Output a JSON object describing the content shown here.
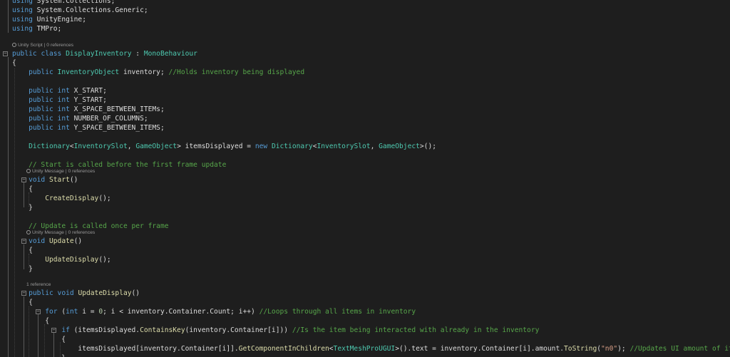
{
  "editor": {
    "colors": {
      "background": "#1e1e1e",
      "keyword": "#569cd6",
      "type": "#4ec9b0",
      "method": "#dcdcaa",
      "comment": "#57a64a",
      "string": "#d69d85",
      "plain": "#dcdcdc"
    },
    "collapse_icon": "minus-box-icon",
    "lines": [
      [
        [
          "kw",
          "using"
        ],
        [
          "pl",
          " System.Collections;"
        ]
      ],
      [
        [
          "kw",
          "using"
        ],
        [
          "pl",
          " System.Collections.Generic;"
        ]
      ],
      [
        [
          "kw",
          "using"
        ],
        [
          "pl",
          " UnityEngine;"
        ]
      ],
      [
        [
          "kw",
          "using"
        ],
        [
          "pl",
          " TMPro;"
        ]
      ],
      [
        [
          "kw",
          "public"
        ],
        [
          "pl",
          " "
        ],
        [
          "kw",
          "class"
        ],
        [
          "pl",
          " "
        ],
        [
          "ty",
          "DisplayInventory"
        ],
        [
          "pl",
          " : "
        ],
        [
          "ty",
          "MonoBehaviour"
        ]
      ],
      [
        [
          "pl",
          "{"
        ]
      ],
      [
        [
          "pl",
          "    "
        ],
        [
          "kw",
          "public"
        ],
        [
          "pl",
          " "
        ],
        [
          "ty",
          "InventoryObject"
        ],
        [
          "pl",
          " inventory; "
        ],
        [
          "cm",
          "//Holds inventory being displayed"
        ]
      ],
      [
        [
          "pl",
          ""
        ]
      ],
      [
        [
          "pl",
          "    "
        ],
        [
          "kw",
          "public"
        ],
        [
          "pl",
          " "
        ],
        [
          "kw",
          "int"
        ],
        [
          "pl",
          " X_START;"
        ]
      ],
      [
        [
          "pl",
          "    "
        ],
        [
          "kw",
          "public"
        ],
        [
          "pl",
          " "
        ],
        [
          "kw",
          "int"
        ],
        [
          "pl",
          " Y_START;"
        ]
      ],
      [
        [
          "pl",
          "    "
        ],
        [
          "kw",
          "public"
        ],
        [
          "pl",
          " "
        ],
        [
          "kw",
          "int"
        ],
        [
          "pl",
          " X_SPACE_BETWEEN_ITEMs;"
        ]
      ],
      [
        [
          "pl",
          "    "
        ],
        [
          "kw",
          "public"
        ],
        [
          "pl",
          " "
        ],
        [
          "kw",
          "int"
        ],
        [
          "pl",
          " NUMBER_OF_COLUMNS;"
        ]
      ],
      [
        [
          "pl",
          "    "
        ],
        [
          "kw",
          "public"
        ],
        [
          "pl",
          " "
        ],
        [
          "kw",
          "int"
        ],
        [
          "pl",
          " Y_SPACE_BETWEEN_ITEMS;"
        ]
      ],
      [
        [
          "pl",
          ""
        ]
      ],
      [
        [
          "pl",
          "    "
        ],
        [
          "ty",
          "Dictionary"
        ],
        [
          "pl",
          "<"
        ],
        [
          "ty",
          "InventorySlot"
        ],
        [
          "pl",
          ", "
        ],
        [
          "ty",
          "GameObject"
        ],
        [
          "pl",
          "> itemsDisplayed = "
        ],
        [
          "kw",
          "new"
        ],
        [
          "pl",
          " "
        ],
        [
          "ty",
          "Dictionary"
        ],
        [
          "pl",
          "<"
        ],
        [
          "ty",
          "InventorySlot"
        ],
        [
          "pl",
          ", "
        ],
        [
          "ty",
          "GameObject"
        ],
        [
          "pl",
          ">();"
        ]
      ],
      [
        [
          "pl",
          ""
        ]
      ],
      [
        [
          "pl",
          "    "
        ],
        [
          "cm",
          "// Start is called before the first frame update"
        ]
      ],
      [
        [
          "pl",
          "    "
        ],
        [
          "kw",
          "void"
        ],
        [
          "pl",
          " "
        ],
        [
          "fn",
          "Start"
        ],
        [
          "pl",
          "()"
        ]
      ],
      [
        [
          "pl",
          "    {"
        ]
      ],
      [
        [
          "pl",
          "        "
        ],
        [
          "fn",
          "CreateDisplay"
        ],
        [
          "pl",
          "();"
        ]
      ],
      [
        [
          "pl",
          "    }"
        ]
      ],
      [
        [
          "pl",
          ""
        ]
      ],
      [
        [
          "pl",
          "    "
        ],
        [
          "cm",
          "// Update is called once per frame"
        ]
      ],
      [
        [
          "pl",
          "    "
        ],
        [
          "kw",
          "void"
        ],
        [
          "pl",
          " "
        ],
        [
          "fn",
          "Update"
        ],
        [
          "pl",
          "()"
        ]
      ],
      [
        [
          "pl",
          "    {"
        ]
      ],
      [
        [
          "pl",
          "        "
        ],
        [
          "fn",
          "UpdateDisplay"
        ],
        [
          "pl",
          "();"
        ]
      ],
      [
        [
          "pl",
          "    }"
        ]
      ],
      [
        [
          "pl",
          ""
        ]
      ],
      [
        [
          "pl",
          "    "
        ],
        [
          "kw",
          "public"
        ],
        [
          "pl",
          " "
        ],
        [
          "kw",
          "void"
        ],
        [
          "pl",
          " "
        ],
        [
          "fn",
          "UpdateDisplay"
        ],
        [
          "pl",
          "()"
        ]
      ],
      [
        [
          "pl",
          "    {"
        ]
      ],
      [
        [
          "pl",
          "        "
        ],
        [
          "kw",
          "for"
        ],
        [
          "pl",
          " ("
        ],
        [
          "kw",
          "int"
        ],
        [
          "pl",
          " i = "
        ],
        [
          "nu",
          "0"
        ],
        [
          "pl",
          "; i < inventory.Container.Count; i++) "
        ],
        [
          "cm",
          "//Loops through all items in inventory"
        ]
      ],
      [
        [
          "pl",
          "        {"
        ]
      ],
      [
        [
          "pl",
          "            "
        ],
        [
          "kw",
          "if"
        ],
        [
          "pl",
          " (itemsDisplayed."
        ],
        [
          "fn",
          "ContainsKey"
        ],
        [
          "pl",
          "(inventory.Container[i])) "
        ],
        [
          "cm",
          "//Is the item being interacted with already in the inventory"
        ]
      ],
      [
        [
          "pl",
          "            {"
        ]
      ],
      [
        [
          "pl",
          "                itemsDisplayed[inventory.Container[i]]."
        ],
        [
          "fn",
          "GetComponentInChildren"
        ],
        [
          "pl",
          "<"
        ],
        [
          "ty",
          "TextMeshProUGUI"
        ],
        [
          "pl",
          ">().text = inventory.Container[i].amount."
        ],
        [
          "fn",
          "ToString"
        ],
        [
          "pl",
          "("
        ],
        [
          "st",
          "\"n0\""
        ],
        [
          "pl",
          "); "
        ],
        [
          "cm",
          "//Updates UI amount of item in invento"
        ]
      ],
      [
        [
          "pl",
          "            }"
        ]
      ]
    ],
    "codelens": [
      {
        "text": "Unity Script | 0 references",
        "icon": true
      },
      {
        "text": "Unity Message | 0 references",
        "icon": true
      },
      {
        "text": "Unity Message | 0 references",
        "icon": true
      },
      {
        "text": "1 reference",
        "icon": false
      }
    ]
  }
}
